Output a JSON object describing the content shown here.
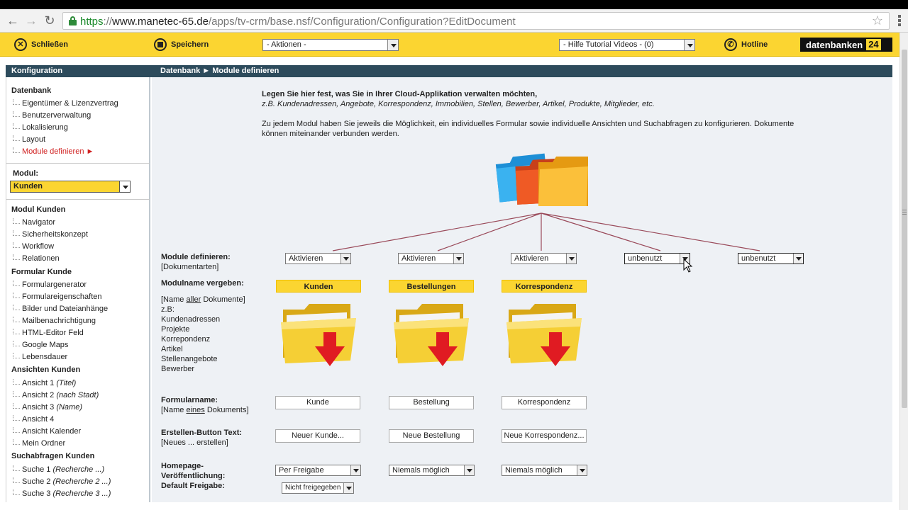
{
  "browser": {
    "url_scheme": "https",
    "url_host": "www.manetec-65.de",
    "url_path": "/apps/tv-crm/base.nsf/Configuration/Configuration?EditDocument",
    "url_sep": "://"
  },
  "toolbar": {
    "close_label": "Schließen",
    "save_label": "Speichern",
    "actions_select": "- Aktionen -",
    "help_select": "- Hilfe Tutorial Videos -   (0)",
    "hotline_label": "Hotline",
    "logo_text": "datenbanken",
    "logo_num": "24"
  },
  "header": {
    "left_title": "Konfiguration",
    "breadcrumb": "Datenbank ► Module definieren"
  },
  "sidebar": {
    "datenbank_head": "Datenbank",
    "datenbank_items": [
      "Eigentümer & Lizenzvertrag",
      "Benutzerverwaltung",
      "Lokalisierung",
      "Layout",
      "Module definieren ►"
    ],
    "modul_label": "Modul:",
    "modul_value": "Kunden",
    "modul_kunden_head": "Modul Kunden",
    "modul_kunden_items": [
      "Navigator",
      "Sicherheitskonzept",
      "Workflow",
      "Relationen"
    ],
    "formular_head": "Formular Kunde",
    "formular_items": [
      "Formulargenerator",
      "Formulareigenschaften",
      "Bilder und Dateianhänge",
      "Mailbenachrichtigung",
      "HTML-Editor Feld",
      "Google Maps",
      "Lebensdauer"
    ],
    "ansichten_head": "Ansichten Kunden",
    "ansichten_items": [
      {
        "name": "Ansicht 1",
        "note": "(Titel)"
      },
      {
        "name": "Ansicht 2",
        "note": "(nach Stadt)"
      },
      {
        "name": "Ansicht 3",
        "note": "(Name)"
      },
      {
        "name": "Ansicht 4",
        "note": ""
      },
      {
        "name": "Ansicht Kalender",
        "note": ""
      },
      {
        "name": "Mein Ordner",
        "note": ""
      }
    ],
    "such_head": "Suchabfragen Kunden",
    "such_items": [
      {
        "name": "Suche 1",
        "note": "(Recherche ...)"
      },
      {
        "name": "Suche 2",
        "note": "(Recherche 2 ...)"
      },
      {
        "name": "Suche 3",
        "note": "(Recherche 3 ...)"
      }
    ]
  },
  "main": {
    "intro_bold": "Legen Sie hier fest, was Sie in Ihrer Cloud-Applikation verwalten möchten,",
    "intro_example": "z.B. Kundenadressen, Angebote, Korrespondenz, Immobilien, Stellen, Bewerber, Artikel, Produkte, Mitglieder, etc.",
    "intro_text": "Zu jedem Modul haben Sie jeweils die Möglichkeit, ein individuelles Formular sowie individuelle Ansichten und Suchabfragen zu konfigurieren. Dokumente können miteinander verbunden werden.",
    "define_label": "Module definieren:",
    "define_sub": "[Dokumentarten]",
    "module_states": [
      "Aktivieren",
      "Aktivieren",
      "Aktivieren",
      "unbenutzt",
      "unbenutzt"
    ],
    "name_label": "Modulname vergeben:",
    "name_sub_a": "[Name ",
    "name_sub_u": "aller",
    "name_sub_b": " Dokumente]",
    "name_examples": [
      "z.B:",
      "Kundenadressen",
      "Projekte",
      "Korrepondenz",
      "Artikel",
      "Stellenangebote",
      "Bewerber"
    ],
    "module_names": [
      "Kunden",
      "Bestellungen",
      "Korrespondenz"
    ],
    "form_label": "Formularname:",
    "form_sub_a": "[Name ",
    "form_sub_u": "eines",
    "form_sub_b": " Dokuments]",
    "form_names": [
      "Kunde",
      "Bestellung",
      "Korrespondenz"
    ],
    "button_label": "Erstellen-Button Text:",
    "button_sub": "[Neues ... erstellen]",
    "button_texts": [
      "Neuer Kunde...",
      "Neue Bestellung",
      "Neue Korrespondenz..."
    ],
    "homepage_label_1": "Homepage-",
    "homepage_label_2": "Veröffentlichung:",
    "homepage_label_3": "Default Freigabe:",
    "homepage_values": [
      "Per Freigabe",
      "Niemals möglich",
      "Niemals möglich"
    ],
    "default_freigabe": "Nicht freigegeben"
  },
  "colors": {
    "toolbar_yellow": "#fbd531",
    "header_blue": "#2d4b5c",
    "active_red": "#d02020",
    "connector_line": "#9a4a5a"
  }
}
